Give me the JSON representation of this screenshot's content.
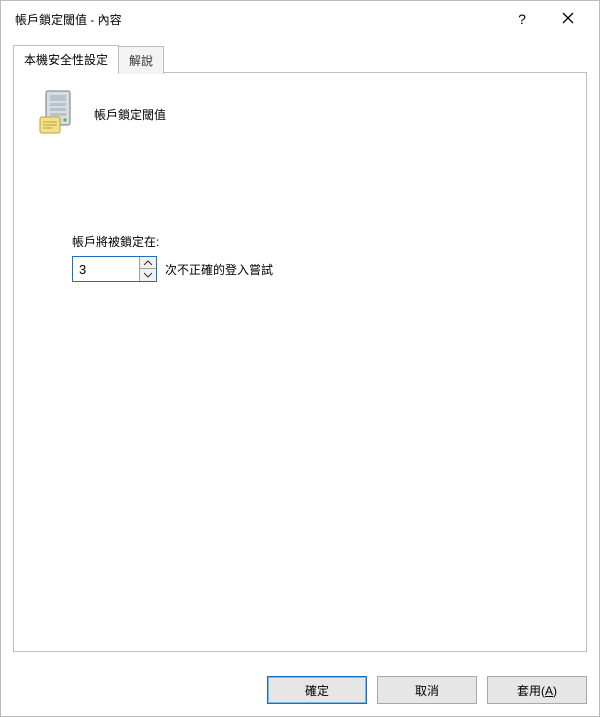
{
  "titlebar": {
    "title": "帳戶鎖定閾值 - 內容",
    "help_symbol": "?"
  },
  "tabs": {
    "local_security_setting": "本機安全性設定",
    "explain": "解說"
  },
  "policy": {
    "name": "帳戶鎖定閾值"
  },
  "setting": {
    "label": "帳戶將被鎖定在:",
    "value": "3",
    "suffix": "次不正確的登入嘗試"
  },
  "buttons": {
    "ok": "確定",
    "cancel": "取消",
    "apply": "套用",
    "apply_accel": "A"
  }
}
